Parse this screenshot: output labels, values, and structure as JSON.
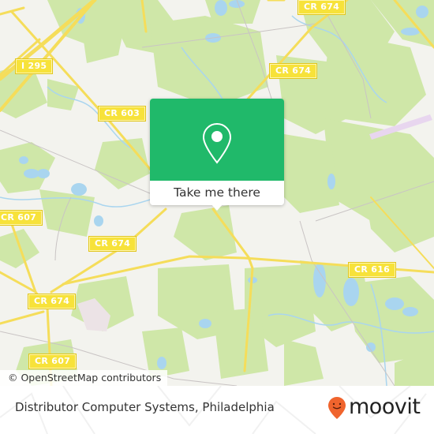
{
  "map": {
    "road_labels": [
      {
        "id": "cr674-top",
        "text": "CR 674"
      },
      {
        "id": "i295",
        "text": "I 295"
      },
      {
        "id": "cr674-right",
        "text": "CR 674"
      },
      {
        "id": "cr603",
        "text": "CR 603"
      },
      {
        "id": "cr607-left",
        "text": "CR 607"
      },
      {
        "id": "cr674-mid",
        "text": "CR 674"
      },
      {
        "id": "cr616",
        "text": "CR 616"
      },
      {
        "id": "cr674-left",
        "text": "CR 674"
      },
      {
        "id": "cr607-bottom",
        "text": "CR 607"
      }
    ],
    "colors": {
      "land": "#f3f3ee",
      "park": "#cfe7a8",
      "water": "#a9d5ef",
      "road": "#f5dd5a",
      "road_label_bg": "#f7e23a",
      "industrial": "#ece3e6",
      "airport": "#e8d6ef"
    },
    "attribution": "© OpenStreetMap contributors"
  },
  "popup": {
    "icon": "map-pin-icon",
    "button_label": "Take me there",
    "accent_color": "#20b96a"
  },
  "footer": {
    "title": "Distributor Computer Systems, Philadelphia",
    "logo_text": "moovit",
    "logo_icon": "moovit-pin-icon",
    "logo_color": "#f0642d"
  }
}
